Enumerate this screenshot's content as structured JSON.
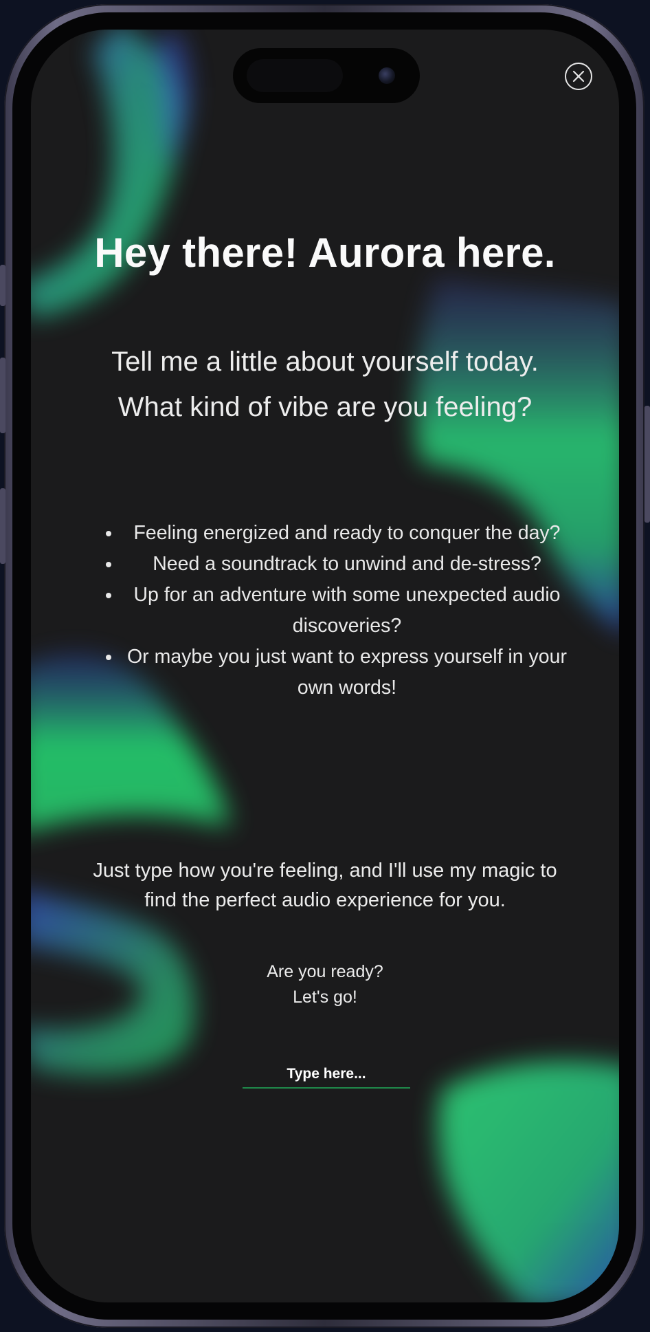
{
  "app": {
    "title": "Hey there! Aurora here.",
    "subtitle_line1": "Tell me a little about yourself today.",
    "subtitle_line2": "What kind of vibe are you feeling?"
  },
  "bullets": [
    "Feeling energized and ready to conquer the day?",
    "Need a soundtrack to unwind and de-stress?",
    "Up for an adventure with some unexpected audio discoveries?",
    "Or maybe you just want to express yourself in your own words!"
  ],
  "instruction": "Just type how you're feeling, and I'll use my magic to find the perfect audio experience for you.",
  "ready_line1": "Are you ready?",
  "ready_line2": "Let's go!",
  "input": {
    "placeholder": "Type here...",
    "value": ""
  },
  "icons": {
    "close": "close-icon",
    "camera": "camera-icon"
  },
  "colors": {
    "background": "#1b1b1c",
    "aurora_green": "#2ee07a",
    "aurora_blue": "#3a5fd8",
    "accent_underline": "#1f8a4a",
    "text": "#fafafa"
  }
}
